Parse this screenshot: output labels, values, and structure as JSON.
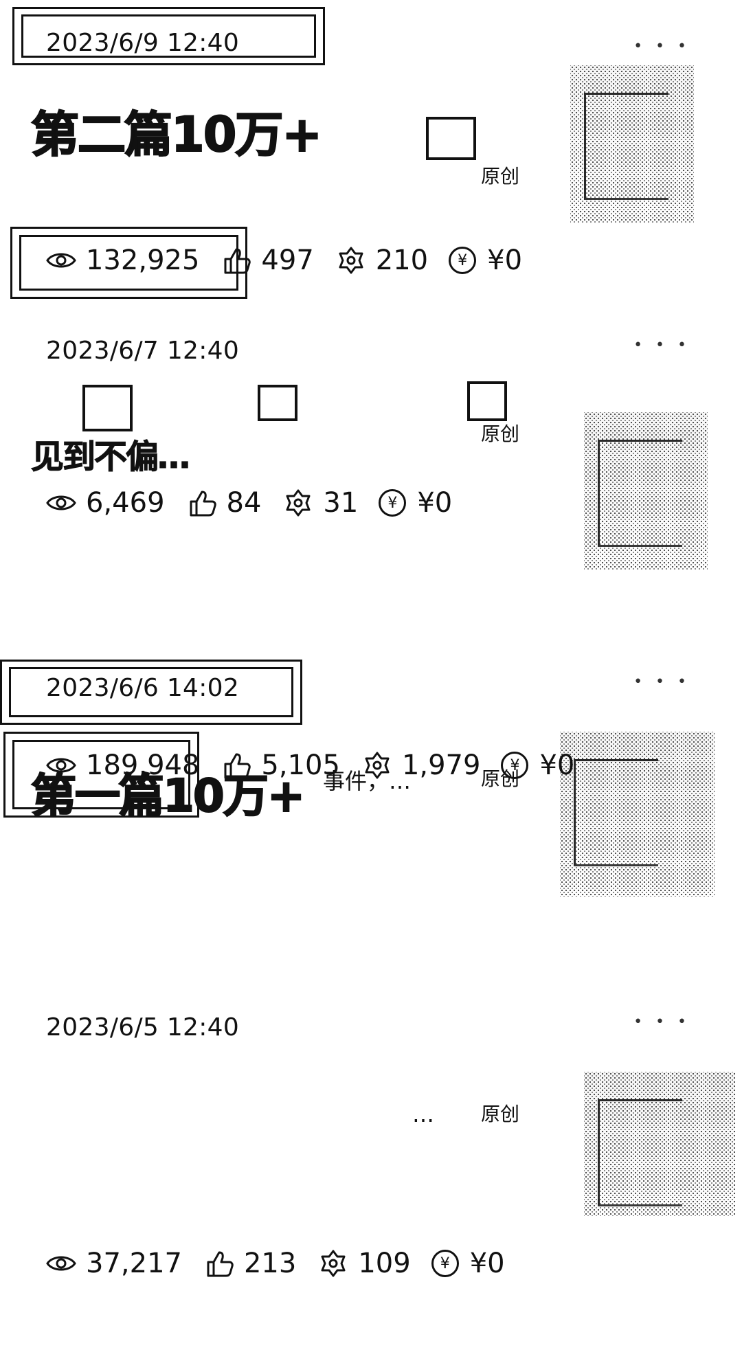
{
  "posts": [
    {
      "date": "2023/6/9 12:40",
      "menu": "• • •",
      "title": "第二篇10万+",
      "tag": "原创",
      "views": "132,925",
      "likes": "497",
      "shares": "210",
      "reward": "¥0"
    },
    {
      "date": "2023/6/7 12:40",
      "menu": "• • •",
      "title": "见到不偏…",
      "tag": "原创",
      "views": "6,469",
      "likes": "84",
      "shares": "31",
      "reward": "¥0"
    },
    {
      "date": "2023/6/6 14:02",
      "menu": "• • •",
      "title": "第一篇10万+",
      "subtitle": "事件，…",
      "tag": "原创",
      "views": "189,948",
      "likes": "5,105",
      "shares": "1,979",
      "reward": "¥0"
    },
    {
      "date": "2023/6/5 12:40",
      "menu": "• • •",
      "title": "",
      "subtitle": "…",
      "tag": "原创",
      "views": "37,217",
      "likes": "213",
      "shares": "109",
      "reward": "¥0"
    }
  ],
  "icons": {
    "view": "eye-icon",
    "like": "thumbs-up-icon",
    "share": "share-icon",
    "reward": "yen-circle-icon"
  }
}
